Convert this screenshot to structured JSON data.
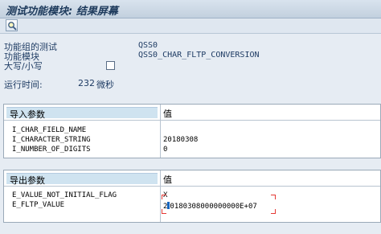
{
  "window": {
    "title": "测试功能模块: 结果屏幕"
  },
  "toolbar": {
    "icons": [
      "magnifier-icon"
    ]
  },
  "header": {
    "group_label": "功能组的测试",
    "group_value": "QSS0",
    "module_label": "功能模块",
    "module_value": "QSS0_CHAR_FLTP_CONVERSION",
    "case_label": "大写/小写",
    "case_checked": false,
    "runtime_label": "运行时间:",
    "runtime_value": "232",
    "runtime_unit": "微秒"
  },
  "import_table": {
    "col_name": "导入参数",
    "col_value": "值",
    "rows": [
      {
        "name": "I_CHAR_FIELD_NAME",
        "value": ""
      },
      {
        "name": "I_CHARACTER_STRING",
        "value": "20180308"
      },
      {
        "name": "I_NUMBER_OF_DIGITS",
        "value": "0"
      }
    ]
  },
  "export_table": {
    "col_name": "导出参数",
    "col_value": "值",
    "rows": [
      {
        "name": "E_VALUE_NOT_INITIAL_FLAG",
        "value": "X"
      },
      {
        "name": "E_FLTP_VALUE",
        "value_prefix": "2",
        "value_rest": "0180308000000000E+07"
      }
    ]
  },
  "colors": {
    "label": "#1f3c64",
    "header_band": "#cfe3f0",
    "highlight_bracket": "#e53935",
    "cursor": "#1565c0"
  }
}
